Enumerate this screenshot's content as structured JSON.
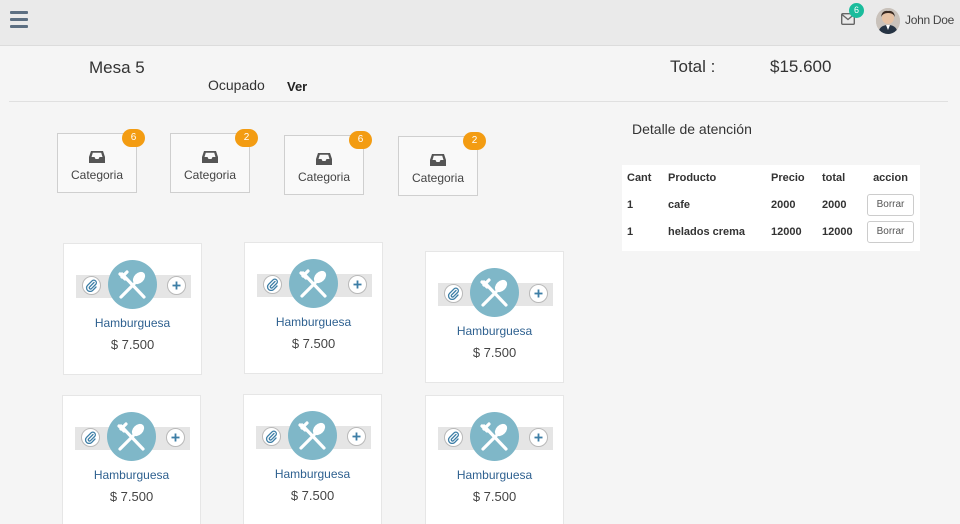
{
  "header": {
    "mail_count": "6",
    "user_name": "John Doe"
  },
  "table_info": {
    "mesa": "Mesa 5",
    "estado": "Ocupado",
    "ver": "Ver",
    "total_label": "Total :",
    "total_value": "$15.600"
  },
  "categories": [
    {
      "label": "Categoria",
      "count": "6"
    },
    {
      "label": "Categoria",
      "count": "2"
    },
    {
      "label": "Categoria",
      "count": "6"
    },
    {
      "label": "Categoria",
      "count": "2"
    }
  ],
  "products": [
    {
      "name": "Hamburguesa",
      "price": "$ 7.500"
    },
    {
      "name": "Hamburguesa",
      "price": "$ 7.500"
    },
    {
      "name": "Hamburguesa",
      "price": "$ 7.500"
    },
    {
      "name": "Hamburguesa",
      "price": "$ 7.500"
    },
    {
      "name": "Hamburguesa",
      "price": "$ 7.500"
    },
    {
      "name": "Hamburguesa",
      "price": "$ 7.500"
    }
  ],
  "detalle": {
    "title": "Detalle de atención",
    "columns": [
      "Cant",
      "Producto",
      "Precio",
      "total",
      "accion"
    ],
    "rows": [
      {
        "cant": "1",
        "producto": "cafe",
        "precio": "2000",
        "total": "2000",
        "accion": "Borrar"
      },
      {
        "cant": "1",
        "producto": "helados crema",
        "precio": "12000",
        "total": "12000",
        "accion": "Borrar"
      }
    ]
  },
  "colors": {
    "badge_orange": "#f39c12",
    "mail_badge": "#1abc9c",
    "product_circle": "#7fb7c8",
    "product_name": "#2f6190"
  }
}
